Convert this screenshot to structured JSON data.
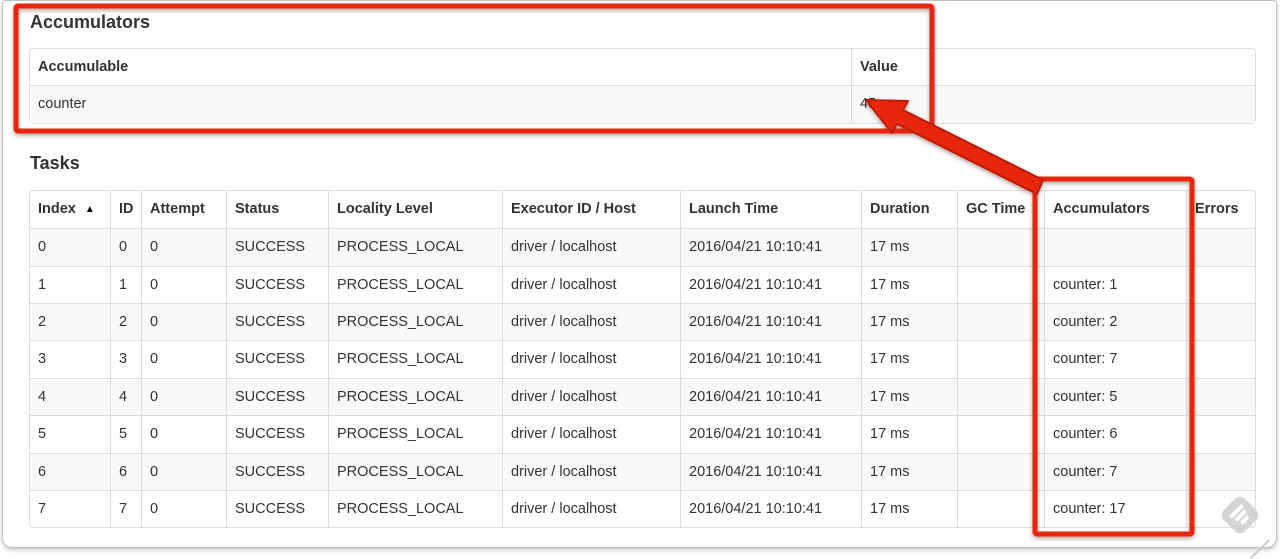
{
  "colors": {
    "annotation_red": "#e8260d",
    "annotation_red_dark": "#bd1d06",
    "watermark_gray": "#d4d4d4",
    "table_border": "#dddddd",
    "stripe_bg": "#f9f9f9"
  },
  "accumulators_section": {
    "title": "Accumulators",
    "table": {
      "headers": [
        "Accumulable",
        "Value"
      ],
      "rows": [
        [
          "counter",
          "45"
        ]
      ]
    }
  },
  "tasks_section": {
    "title": "Tasks",
    "table": {
      "headers": [
        "Index",
        "ID",
        "Attempt",
        "Status",
        "Locality Level",
        "Executor ID / Host",
        "Launch Time",
        "Duration",
        "GC Time",
        "Accumulators",
        "Errors"
      ],
      "sort_column": "Index",
      "sort_indicator": "▲",
      "rows": [
        [
          "0",
          "0",
          "0",
          "SUCCESS",
          "PROCESS_LOCAL",
          "driver / localhost",
          "2016/04/21 10:10:41",
          "17 ms",
          "",
          "",
          ""
        ],
        [
          "1",
          "1",
          "0",
          "SUCCESS",
          "PROCESS_LOCAL",
          "driver / localhost",
          "2016/04/21 10:10:41",
          "17 ms",
          "",
          "counter: 1",
          ""
        ],
        [
          "2",
          "2",
          "0",
          "SUCCESS",
          "PROCESS_LOCAL",
          "driver / localhost",
          "2016/04/21 10:10:41",
          "17 ms",
          "",
          "counter: 2",
          ""
        ],
        [
          "3",
          "3",
          "0",
          "SUCCESS",
          "PROCESS_LOCAL",
          "driver / localhost",
          "2016/04/21 10:10:41",
          "17 ms",
          "",
          "counter: 7",
          ""
        ],
        [
          "4",
          "4",
          "0",
          "SUCCESS",
          "PROCESS_LOCAL",
          "driver / localhost",
          "2016/04/21 10:10:41",
          "17 ms",
          "",
          "counter: 5",
          ""
        ],
        [
          "5",
          "5",
          "0",
          "SUCCESS",
          "PROCESS_LOCAL",
          "driver / localhost",
          "2016/04/21 10:10:41",
          "17 ms",
          "",
          "counter: 6",
          ""
        ],
        [
          "6",
          "6",
          "0",
          "SUCCESS",
          "PROCESS_LOCAL",
          "driver / localhost",
          "2016/04/21 10:10:41",
          "17 ms",
          "",
          "counter: 7",
          ""
        ],
        [
          "7",
          "7",
          "0",
          "SUCCESS",
          "PROCESS_LOCAL",
          "driver / localhost",
          "2016/04/21 10:10:41",
          "17 ms",
          "",
          "counter: 17",
          ""
        ]
      ]
    }
  }
}
